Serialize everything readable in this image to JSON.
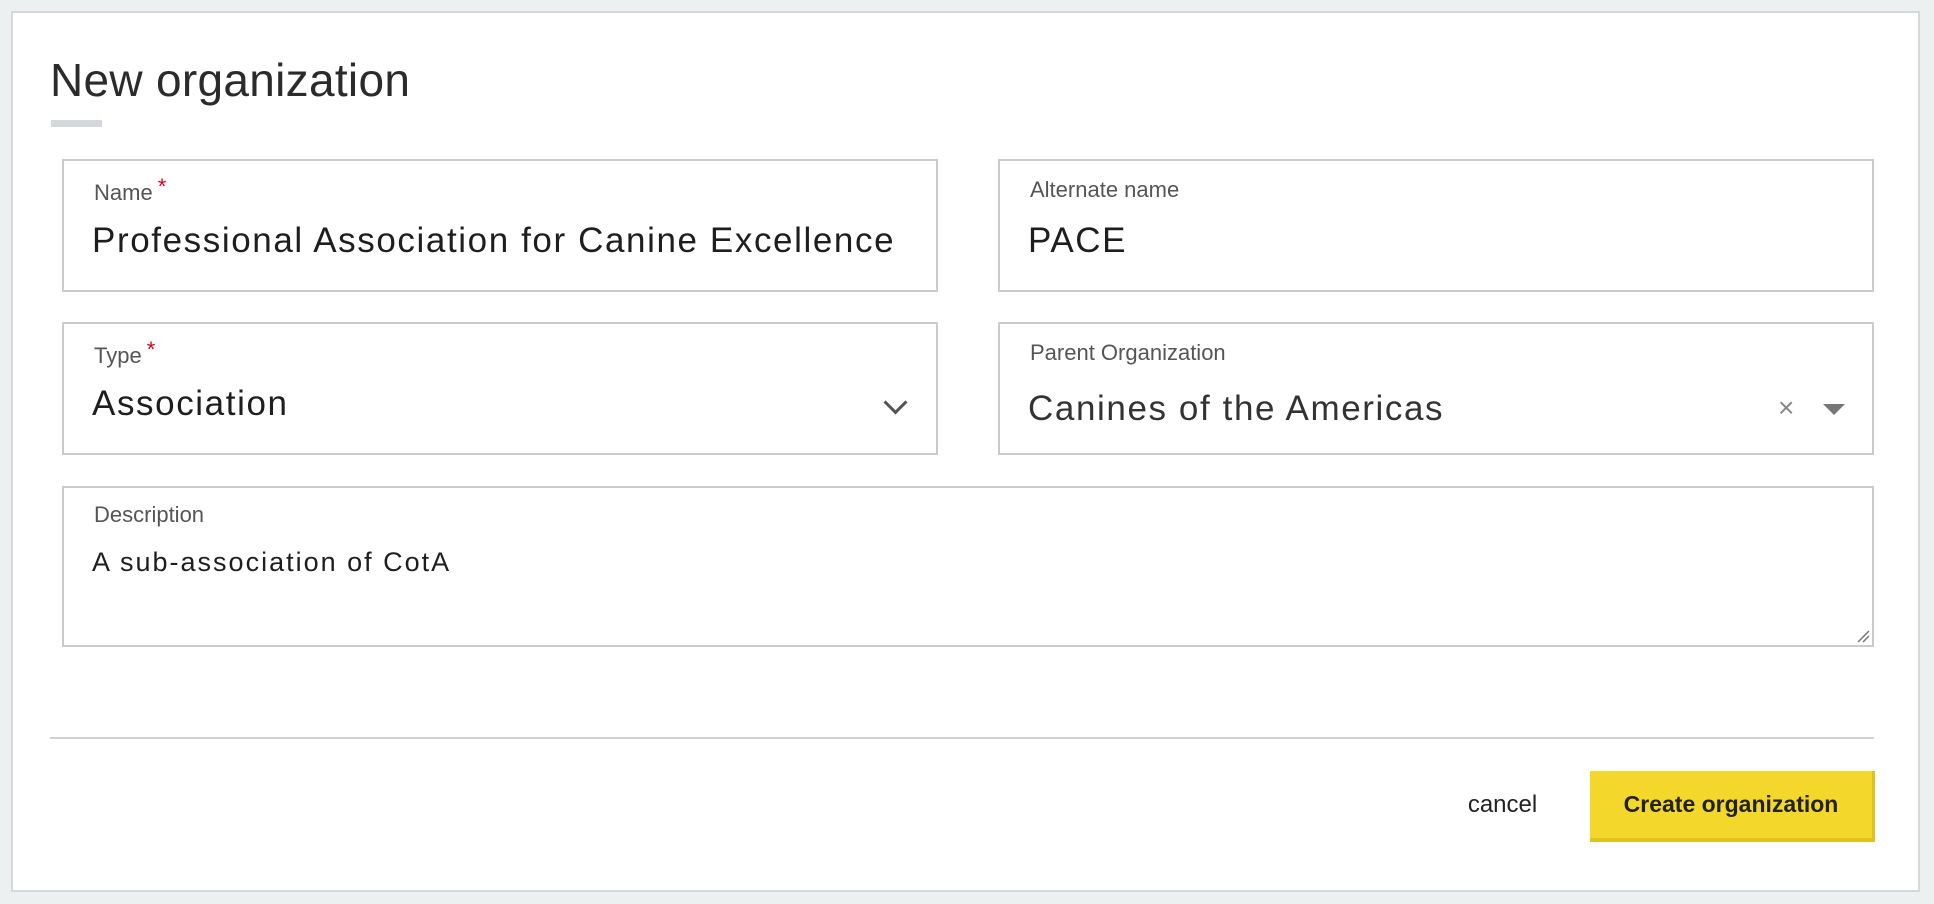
{
  "page": {
    "title": "New organization"
  },
  "form": {
    "name": {
      "label": "Name",
      "required_mark": "*",
      "value": "Professional Association for Canine Excellence"
    },
    "alternate_name": {
      "label": "Alternate name",
      "value": "PACE"
    },
    "type": {
      "label": "Type",
      "required_mark": "*",
      "value": "Association"
    },
    "parent_organization": {
      "label": "Parent Organization",
      "value": "Canines of the Americas",
      "clear_symbol": "×"
    },
    "description": {
      "label": "Description",
      "value": "A sub-association of CotA"
    }
  },
  "actions": {
    "cancel_label": "cancel",
    "create_label": "Create organization"
  },
  "colors": {
    "accent": "#f4d72b",
    "required": "#d0021b"
  }
}
